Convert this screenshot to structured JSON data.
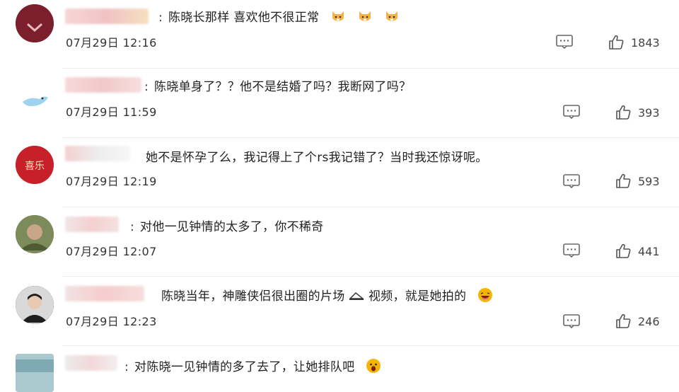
{
  "comments": [
    {
      "text": "陈晓长那样 喜欢他不很正常",
      "date": "07月29日 12:16",
      "likes": "1843",
      "avatar_color": "#7a1f2b",
      "emoji": [
        "dog-face-icon",
        "dog-face-icon",
        "dog-face-icon"
      ]
    },
    {
      "text": "陈晓单身了？？他不是结婚了吗？我断网了吗？",
      "date": "07月29日 11:59",
      "likes": "393",
      "avatar_color": "#dff0ff",
      "emoji": []
    },
    {
      "text": "她不是怀孕了么，我记得上了个rs我记错了？当时我还惊讶呢。",
      "date": "07月29日 12:19",
      "likes": "593",
      "avatar_color": "#c8202a",
      "avatar_text": "喜乐",
      "emoji": []
    },
    {
      "text": "对他一见钟情的太多了，你不稀奇",
      "date": "07月29日 12:07",
      "likes": "441",
      "avatar_color": "#6c7a4c",
      "emoji": []
    },
    {
      "text": "陈晓当年，神雕侠侣很出圈的片场",
      "text_tail": "视频，就是她拍的",
      "date": "07月29日 12:23",
      "likes": "246",
      "avatar_color": "#2c2c2c",
      "emoji": [
        "laughing-face-icon"
      ]
    },
    {
      "text": "对陈晓一见钟情的多了去了，让她排队吧",
      "date": "",
      "likes": "",
      "avatar_color": "#9fc1c9",
      "emoji": [
        "surprised-face-icon"
      ]
    }
  ],
  "colors": {
    "blur_pink": "#f4c9c9",
    "blur_grey": "#e4e4e4"
  }
}
